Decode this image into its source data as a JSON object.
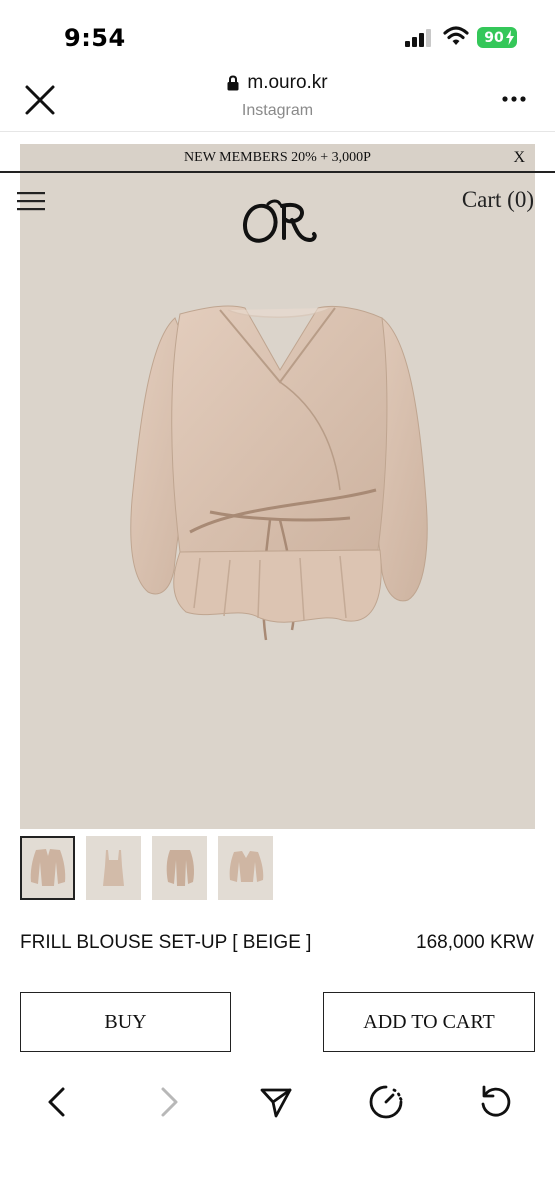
{
  "status_bar": {
    "time": "9:54",
    "battery": "90",
    "icons": [
      "signal-icon",
      "wifi-icon",
      "battery-icon"
    ]
  },
  "browser": {
    "url": "m.ouro.kr",
    "subtitle": "Instagram",
    "icons": [
      "close-icon",
      "lock-icon",
      "more-icon"
    ]
  },
  "site": {
    "promo_text": "NEW MEMBERS 20% + 3,000P",
    "promo_close": "X",
    "cart_label": "Cart (0)",
    "logo_text": "OR",
    "background_color": "#dbd4cb"
  },
  "product": {
    "name": "FRILL BLOUSE SET-UP [ BEIGE ]",
    "price": "168,000 KRW",
    "thumbnail_count": 4,
    "buy_label": "BUY",
    "add_to_cart_label": "ADD TO CART"
  },
  "toolbar": {
    "icons": [
      "back-icon",
      "forward-icon",
      "share-icon",
      "speed-icon",
      "reload-icon"
    ]
  }
}
